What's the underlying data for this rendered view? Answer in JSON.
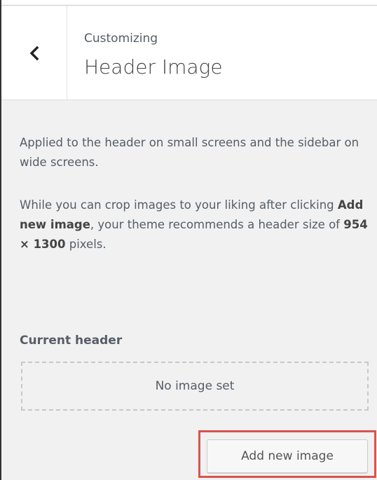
{
  "header": {
    "subtitle": "Customizing",
    "title": "Header Image",
    "back_icon": "chevron-left-icon"
  },
  "content": {
    "desc1": "Applied to the header on small screens and the sidebar on wide screens.",
    "desc2_part1": "While you can crop images to your liking after clicking ",
    "desc2_link": "Add new image",
    "desc2_part2": ", your theme recommends a header size of ",
    "desc2_size": "954 × 1300",
    "desc2_part3": " pixels.",
    "current_header_label": "Current header",
    "no_image_text": "No image set",
    "add_button_label": "Add new image"
  },
  "colors": {
    "panel_bg": "#f1f1f1",
    "highlight": "#d9534f"
  }
}
